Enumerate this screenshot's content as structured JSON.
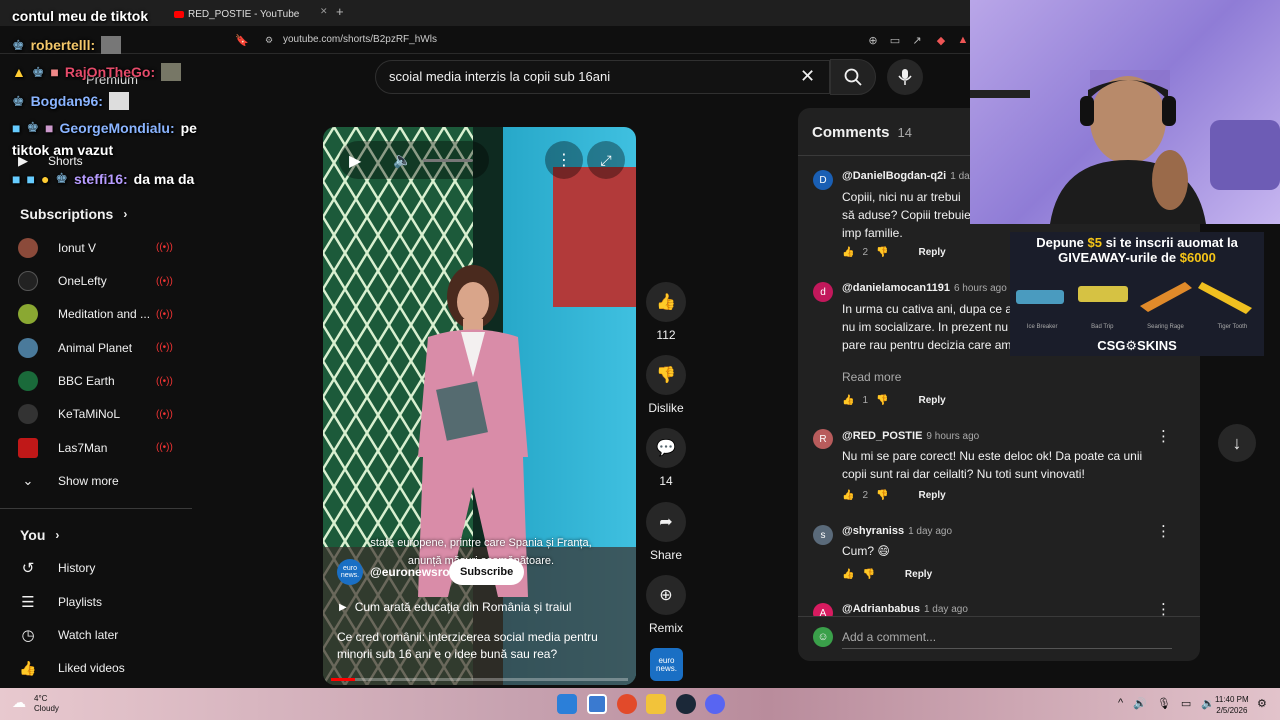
{
  "browser": {
    "tab_title": "RED_POSTIE - YouTube",
    "new_tab": "+",
    "url": "youtube.com/shorts/B2pzRF_hWls"
  },
  "search": {
    "query": "scoial media interzis la copii sub 16ani"
  },
  "sidebar": {
    "shorts_label": "Shorts",
    "premium_label": "Premium",
    "subscriptions_title": "Subscriptions",
    "subscriptions": [
      {
        "label": "Ionut V",
        "color": "#8b4a3a"
      },
      {
        "label": "OneLefty",
        "color": "#222222"
      },
      {
        "label": "Meditation and ...",
        "color": "#8aa832"
      },
      {
        "label": "Animal Planet",
        "color": "#4a7a9b"
      },
      {
        "label": "BBC Earth",
        "color": "#1a6a3a"
      },
      {
        "label": "KeTaMiNoL",
        "color": "#333333"
      },
      {
        "label": "Las7Man",
        "color": "#c01818"
      }
    ],
    "show_more": "Show more",
    "you_title": "You",
    "you_items": [
      "History",
      "Playlists",
      "Watch later",
      "Liked videos"
    ]
  },
  "video": {
    "caption_line1": "state europene, printre care Spania și Franța,",
    "caption_line2": "anunță măsuri asemănătoare.",
    "channel": "@euronewsro",
    "subscribe": "Subscribe",
    "playlist_link": "Cum arată educația din România și traiul",
    "title": "Ce cred românii: interzicerea social media pentru minorii sub 16 ani e o idee bună sau rea?",
    "progress": 0.08
  },
  "actions": {
    "likes": "112",
    "dislike": "Dislike",
    "comments": "14",
    "share": "Share",
    "remix": "Remix",
    "channel_logo": "euro news."
  },
  "comments_panel": {
    "title": "Comments",
    "count": "14",
    "reply_label": "Reply",
    "read_more": "Read more",
    "add_placeholder": "Add a comment...",
    "items": [
      {
        "avatar": "D",
        "color": "#1a5fb4",
        "user": "@DanielBogdan-q2i",
        "time": "1 day a",
        "text": "Copiii, nici nu ar trebui să aduse? Copiii trebuie imp familie.",
        "likes": "2"
      },
      {
        "avatar": "d",
        "color": "#c2185b",
        "user": "@danielamocan1191",
        "time": "6 hours ago (e",
        "text": "In urma cu cativa ani, dupa ce a e mai bine pentru mine sa nu im socializare. In prezent nu am cor sau twiter. Nu imi pare rau pentru decizia care am luat-o. ...",
        "likes": "1"
      },
      {
        "avatar": "R",
        "color": "#b85c5c",
        "user": "@RED_POSTIE",
        "time": "9 hours ago",
        "text": "Nu mi se pare corect! Nu este deloc ok! Da poate ca unii copii sunt rai dar ceilalti? Nu toti sunt vinovati!",
        "likes": "2"
      },
      {
        "avatar": "s",
        "color": "#5a6a7a",
        "user": "@shyraniss",
        "time": "1 day ago",
        "text": "Cum? 😄",
        "likes": ""
      },
      {
        "avatar": "A",
        "color": "#d81b60",
        "user": "@Adrianbabus",
        "time": "1 day ago",
        "text": "",
        "likes": ""
      }
    ]
  },
  "chat": {
    "lines": [
      {
        "user": "",
        "msg": "contul meu de tiktok"
      },
      {
        "user": "robertelll:",
        "msg": ""
      },
      {
        "user": "RajOnTheGo:",
        "msg": ""
      },
      {
        "user": "Bogdan96:",
        "msg": ""
      },
      {
        "user": "GeorgeMondialu:",
        "msg": "pe"
      },
      {
        "user": "",
        "msg": "tiktok am vazut"
      },
      {
        "user": "steffi16:",
        "msg": "da ma da"
      }
    ]
  },
  "ad": {
    "line1_pre": "Depune ",
    "line1_amount": "$5",
    "line1_post": " si te inscrii auomat la",
    "line2_pre": "GIVEAWAY-urile de ",
    "line2_amount": "$6000",
    "skins": [
      "Ice Breaker",
      "Bad Trip",
      "Searing Rage",
      "Tiger Tooth"
    ],
    "brand": "CSG⚙SKINS"
  },
  "taskbar": {
    "temp": "4°C",
    "weather": "Cloudy",
    "time": "11:40 PM",
    "date": "2/5/2026"
  }
}
